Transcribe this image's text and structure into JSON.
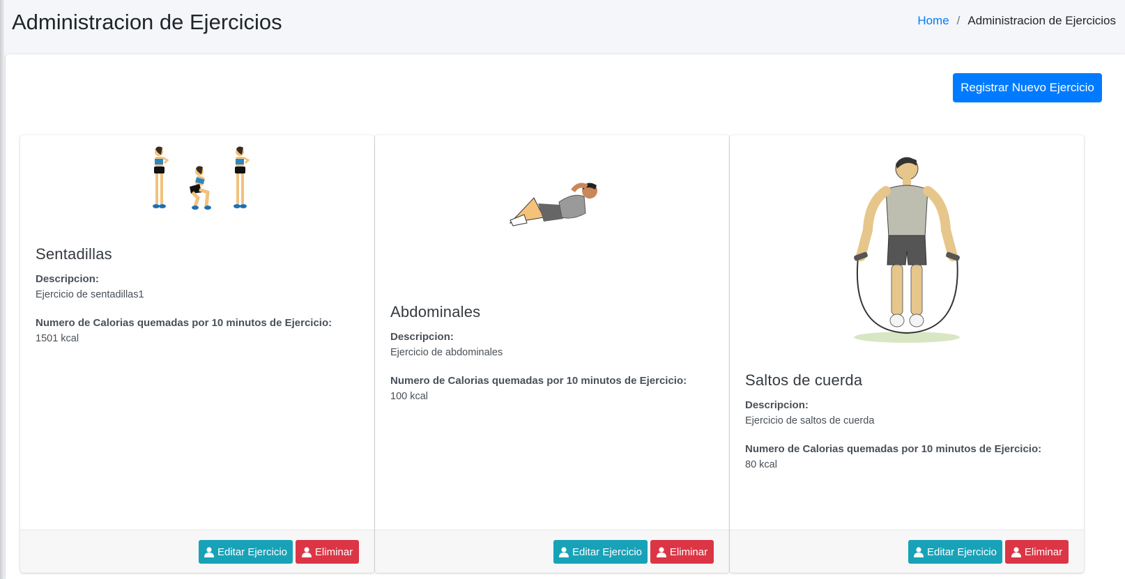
{
  "header": {
    "title": "Administracion de Ejercicios",
    "breadcrumb": {
      "home": "Home",
      "separator": "/",
      "current": "Administracion de Ejercicios"
    }
  },
  "actions": {
    "register_label": "Registrar Nuevo Ejercicio"
  },
  "labels": {
    "description": "Descripcion:",
    "calories": "Numero de Calorias quemadas por 10 minutos de Ejercicio:",
    "edit": "Editar Ejercicio",
    "delete": "Eliminar"
  },
  "exercises": [
    {
      "name": "Sentadillas",
      "description": "Ejercicio de sentadillas1",
      "calories": "1501 kcal",
      "image": "squat-illustration"
    },
    {
      "name": "Abdominales",
      "description": "Ejercicio de abdominales",
      "calories": "100 kcal",
      "image": "situp-illustration"
    },
    {
      "name": "Saltos de cuerda",
      "description": "Ejercicio de saltos de cuerda",
      "calories": "80 kcal",
      "image": "jump-rope-illustration"
    }
  ],
  "colors": {
    "primary": "#007bff",
    "info": "#17a2b8",
    "danger": "#dc3545",
    "background": "#f4f6f9"
  },
  "icons": {
    "edit": "user-icon",
    "delete": "user-icon"
  }
}
